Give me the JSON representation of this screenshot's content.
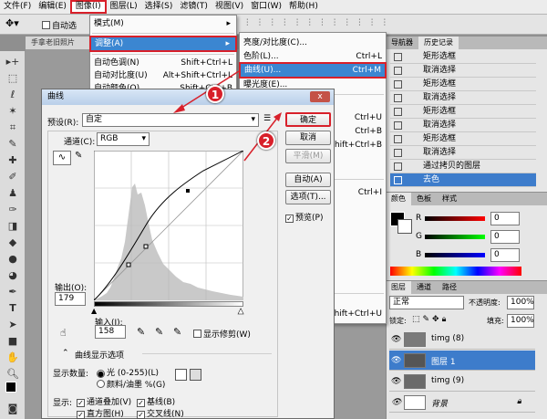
{
  "menubar": {
    "items": [
      "文件(F)",
      "编辑(E)",
      "图像(I)",
      "图层(L)",
      "选择(S)",
      "滤镜(T)",
      "视图(V)",
      "窗口(W)",
      "帮助(H)"
    ]
  },
  "optbar": {
    "auto_select": "自动选"
  },
  "doc_tab": "手拿老旧照片",
  "image_menu": {
    "mode": "模式(M)",
    "adjust": "调整(A)",
    "auto_tone": "自动色调(N)",
    "auto_tone_sc": "Shift+Ctrl+L",
    "auto_contrast": "自动对比度(U)",
    "auto_contrast_sc": "Alt+Shift+Ctrl+L",
    "auto_color": "自动颜色(O)",
    "auto_color_sc": "Shift+Ctrl+B"
  },
  "adjust_menu": {
    "brightness": "亮度/对比度(C)...",
    "levels": "色阶(L)...",
    "levels_sc": "Ctrl+L",
    "curves": "曲线(U)...",
    "curves_sc": "Ctrl+M",
    "exposure": "曝光度(E)...",
    "sc_u": "Ctrl+U",
    "sc_b": "Ctrl+B",
    "sc_shift_b": "Shift+Ctrl+B",
    "sc_i": "Ctrl+I",
    "sc_shift_u": "Shift+Ctrl+U"
  },
  "dialog": {
    "title": "曲线",
    "close": "x",
    "preset_label": "预设(R):",
    "preset_value": "自定",
    "channel_label": "通道(C):",
    "channel_value": "RGB",
    "ok": "确定",
    "cancel": "取消",
    "smooth": "平滑(M)",
    "auto": "自动(A)",
    "options": "选项(T)...",
    "preview": "预览(P)",
    "output_label": "输出(O):",
    "output_value": "179",
    "input_label": "输入(I):",
    "input_value": "158",
    "show_clipping": "显示修剪(W)",
    "display_options": "曲线显示选项",
    "show_amount": "显示数量:",
    "light": "光 (0-255)(L)",
    "pigment": "颜料/油墨 %(G)",
    "show": "显示:",
    "channel_overlay": "通道叠加(V)",
    "baseline": "基线(B)",
    "histogram": "直方图(H)",
    "intersection": "交叉线(N)"
  },
  "history": {
    "tabs": [
      "导航器",
      "历史记录"
    ],
    "items": [
      "矩形选框",
      "取消选择",
      "矩形选框",
      "取消选择",
      "矩形选框",
      "取消选择",
      "矩形选框",
      "取消选择",
      "通过拷贝的图层",
      "去色"
    ]
  },
  "color": {
    "tabs": [
      "颜色",
      "色板",
      "样式"
    ],
    "r": "0",
    "g": "0",
    "b": "0",
    "r_lbl": "R",
    "g_lbl": "G",
    "b_lbl": "B"
  },
  "layers": {
    "tabs": [
      "图层",
      "通道",
      "路径"
    ],
    "blend": "正常",
    "opacity_label": "不透明度:",
    "opacity": "100%",
    "lock_label": "锁定:",
    "fill_label": "填充:",
    "fill": "100%",
    "rows": [
      "timg (8)",
      "图层 1",
      "timg (9)",
      "背景"
    ]
  },
  "badges": [
    "1",
    "2"
  ]
}
